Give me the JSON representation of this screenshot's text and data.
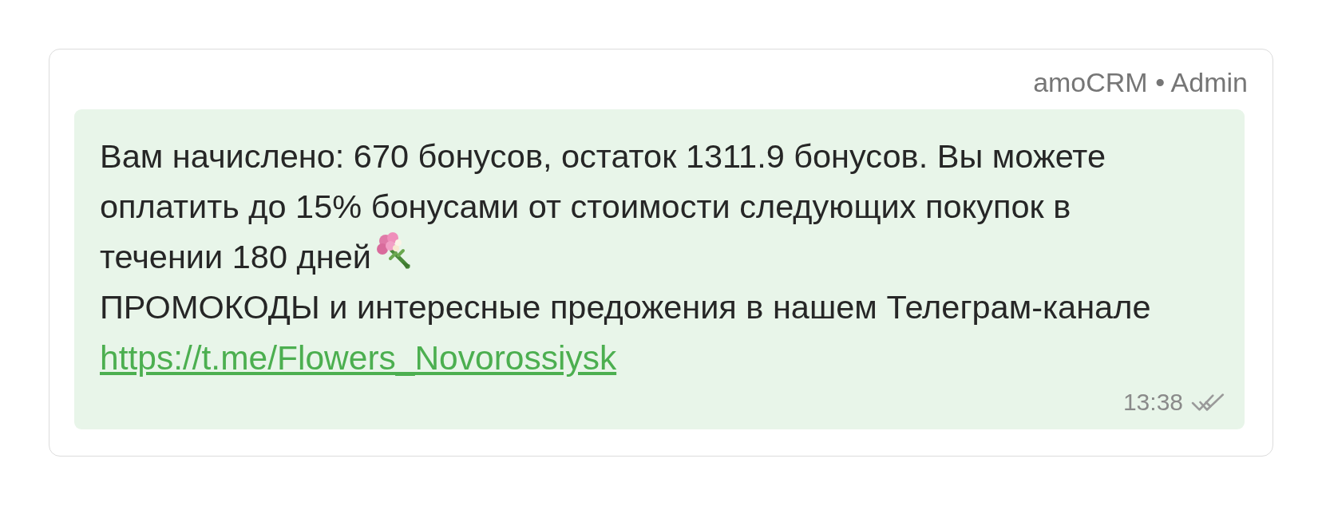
{
  "card": {
    "sender": "amoCRM • Admin"
  },
  "message": {
    "text_lines": [
      "Вам начислено: 670 бонусов, остаток 1311.9 бонусов. Вы можете",
      "оплатить до 15% бонусами от стоимости следующих покупок в",
      "течении 180 дней"
    ],
    "promo": "ПРОМОКОДЫ и интересные предожения в нашем Телеграм-канале",
    "link": "https://t.me/Flowers_Novorossiysk",
    "time": "13:38",
    "read": true
  }
}
